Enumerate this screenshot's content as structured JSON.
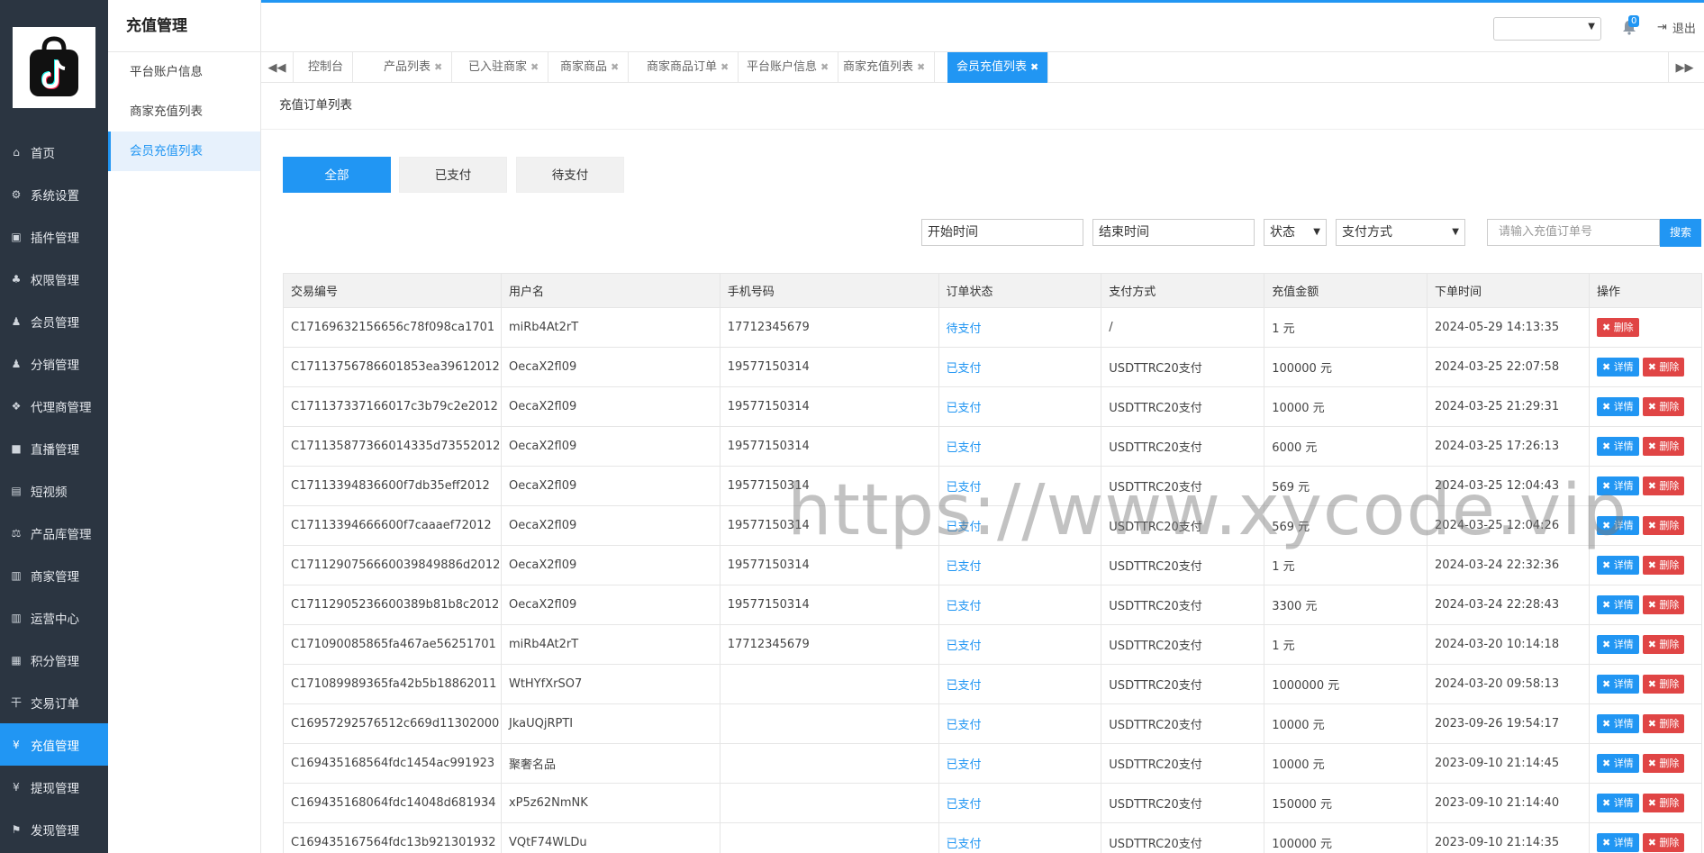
{
  "nav": {
    "items": [
      {
        "label": "首页",
        "icon": "home-icon",
        "glyph": "⌂"
      },
      {
        "label": "系统设置",
        "icon": "gear-icon",
        "glyph": "⚙"
      },
      {
        "label": "插件管理",
        "icon": "plugin-icon",
        "glyph": "▣"
      },
      {
        "label": "权限管理",
        "icon": "sitemap-icon",
        "glyph": "♣"
      },
      {
        "label": "会员管理",
        "icon": "users-icon",
        "glyph": "♟"
      },
      {
        "label": "分销管理",
        "icon": "users-icon",
        "glyph": "♟"
      },
      {
        "label": "代理商管理",
        "icon": "cubes-icon",
        "glyph": "❖"
      },
      {
        "label": "直播管理",
        "icon": "video-icon",
        "glyph": "■"
      },
      {
        "label": "短视频",
        "icon": "file-icon",
        "glyph": "▤"
      },
      {
        "label": "产品库管理",
        "icon": "balance-icon",
        "glyph": "⚖"
      },
      {
        "label": "商家管理",
        "icon": "bank-icon",
        "glyph": "▥"
      },
      {
        "label": "运营中心",
        "icon": "bank-icon",
        "glyph": "▥"
      },
      {
        "label": "积分管理",
        "icon": "document-icon",
        "glyph": "▦"
      },
      {
        "label": "交易订单",
        "icon": "yen-icon",
        "glyph": "干"
      },
      {
        "label": "充值管理",
        "icon": "yen-icon",
        "glyph": "¥",
        "active": true
      },
      {
        "label": "提现管理",
        "icon": "yen-icon",
        "glyph": "¥"
      },
      {
        "label": "发现管理",
        "icon": "flag-icon",
        "glyph": "⚑"
      }
    ]
  },
  "subnav": {
    "title": "充值管理",
    "items": [
      "平台账户信息",
      "商家充值列表",
      "会员充值列表"
    ]
  },
  "topbar": {
    "badge": "0",
    "logout": "退出"
  },
  "tabs": [
    "控制台",
    "产品列表",
    "已入驻商家",
    "商家商品",
    "商家商品订单",
    "平台账户信息",
    "商家充值列表",
    "会员充值列表"
  ],
  "card_title": "充值订单列表",
  "filters": {
    "buttons": [
      "全部",
      "已支付",
      "待支付"
    ],
    "start_time": "开始时间",
    "end_time": "结束时间",
    "status": "状态",
    "pay_method": "支付方式",
    "order_placeholder": "请输入充值订单号",
    "search": "搜索"
  },
  "table": {
    "headers": [
      "交易编号",
      "用户名",
      "手机号码",
      "订单状态",
      "支付方式",
      "充值金额",
      "下单时间",
      "操作"
    ],
    "detail_label": "详情",
    "delete_label": "删除",
    "rows": [
      {
        "id": "C17169632156656c78f098ca1701",
        "user": "miRb4At2rT",
        "phone": "17712345679",
        "status": "待支付",
        "method": "/",
        "amount": "1 元",
        "time": "2024-05-29 14:13:35",
        "detail": false
      },
      {
        "id": "C17113756786601853ea39612012",
        "user": "OecaX2fl09",
        "phone": "19577150314",
        "status": "已支付",
        "method": "USDTTRC20支付",
        "amount": "100000 元",
        "time": "2024-03-25 22:07:58",
        "detail": true
      },
      {
        "id": "C171137337166017c3b79c2e2012",
        "user": "OecaX2fl09",
        "phone": "19577150314",
        "status": "已支付",
        "method": "USDTTRC20支付",
        "amount": "10000 元",
        "time": "2024-03-25 21:29:31",
        "detail": true
      },
      {
        "id": "C17113587736601433 5d73552012",
        "user": "OecaX2fl09",
        "phone": "19577150314",
        "status": "已支付",
        "method": "USDTTRC20支付",
        "amount": "6000 元",
        "time": "2024-03-25 17:26:13",
        "detail": true
      },
      {
        "id": "C17113394836600f7db35eff2012",
        "user": "OecaX2fl09",
        "phone": "19577150314",
        "status": "已支付",
        "method": "USDTTRC20支付",
        "amount": "569 元",
        "time": "2024-03-25 12:04:43",
        "detail": true
      },
      {
        "id": "C17113394666600f7caaaef72012",
        "user": "OecaX2fl09",
        "phone": "19577150314",
        "status": "已支付",
        "method": "USDTTRC20支付",
        "amount": "569 元",
        "time": "2024-03-25 12:04:26",
        "detail": true
      },
      {
        "id": "C17112907566600398 49886d2012",
        "user": "OecaX2fl09",
        "phone": "19577150314",
        "status": "已支付",
        "method": "USDTTRC20支付",
        "amount": "1 元",
        "time": "2024-03-24 22:32:36",
        "detail": true
      },
      {
        "id": "C17112905236600389b81b8c2012",
        "user": "OecaX2fl09",
        "phone": "19577150314",
        "status": "已支付",
        "method": "USDTTRC20支付",
        "amount": "3300 元",
        "time": "2024-03-24 22:28:43",
        "detail": true
      },
      {
        "id": "C171090085865fa467ae56251701",
        "user": "miRb4At2rT",
        "phone": "17712345679",
        "status": "已支付",
        "method": "USDTTRC20支付",
        "amount": "1 元",
        "time": "2024-03-20 10:14:18",
        "detail": true
      },
      {
        "id": "C171089989365fa42b5b18862011",
        "user": "WtHYfXrSO7",
        "phone": "",
        "status": "已支付",
        "method": "USDTTRC20支付",
        "amount": "1000000 元",
        "time": "2024-03-20 09:58:13",
        "detail": true
      },
      {
        "id": "C16957292576512c669d11302000",
        "user": "JkaUQjRPTI",
        "phone": "",
        "status": "已支付",
        "method": "USDTTRC20支付",
        "amount": "10000 元",
        "time": "2023-09-26 19:54:17",
        "detail": true
      },
      {
        "id": "C169435168564fdc1454ac991923",
        "user": "聚奢名品",
        "phone": "",
        "status": "已支付",
        "method": "USDTTRC20支付",
        "amount": "10000 元",
        "time": "2023-09-10 21:14:45",
        "detail": true
      },
      {
        "id": "C169435168064fdc14048d681934",
        "user": "xP5z62NmNK",
        "phone": "",
        "status": "已支付",
        "method": "USDTTRC20支付",
        "amount": "150000 元",
        "time": "2023-09-10 21:14:40",
        "detail": true
      },
      {
        "id": "C169435167564fdc13b921301932",
        "user": "VQtF74WLDu",
        "phone": "",
        "status": "已支付",
        "method": "USDTTRC20支付",
        "amount": "100000 元",
        "time": "2023-09-10 21:14:35",
        "detail": true
      }
    ]
  },
  "watermark": "https://www.xycode.vip"
}
